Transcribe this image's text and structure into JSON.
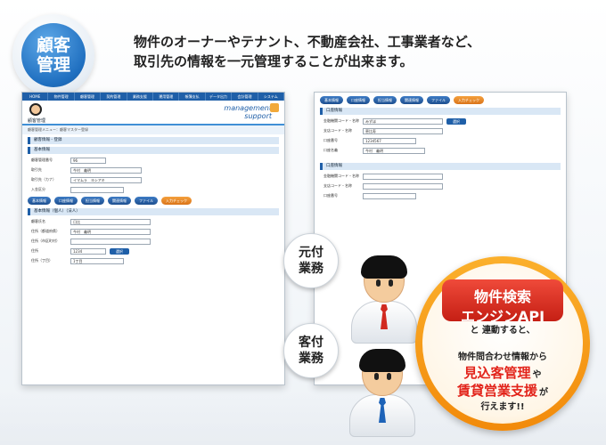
{
  "badge": {
    "line1": "顧客",
    "line2": "管理"
  },
  "headline": {
    "line1": "物件のオーナーやテナント、不動産会社、工事業者など、",
    "line2": "取引先の情報を一元管理することが出来ます。"
  },
  "left_screen": {
    "menu": [
      "HOME",
      "物件管理",
      "顧客管理",
      "契約管理",
      "業務支援",
      "運用管理",
      "帳簿支払",
      "データ出力",
      "会計管理",
      "システム"
    ],
    "user_label": "顧客管理",
    "brand_line1": "management",
    "brand_line2": "support",
    "crumb": "顧客管理メニュー：顧客マスター登録",
    "section1": "顧客情報 - 登録",
    "section2": "基本情報",
    "fields": [
      {
        "label": "顧客管理番号",
        "value": "96"
      },
      {
        "label": "取引先",
        "value": "今村　義明"
      },
      {
        "label": "取引先（カナ）",
        "value": "イマムラ　ヨシアキ"
      },
      {
        "label": "入金区分",
        "value": ""
      }
    ],
    "pills": [
      "基本情報",
      "口座情報",
      "担当情報",
      "関連情報",
      "ファイル"
    ],
    "pill_orange": "入力チェック",
    "section3": "基本情報（個人）（法人）",
    "fields2": [
      {
        "label": "顧客氏名",
        "value": "日比"
      },
      {
        "label": "住所（都道府県）",
        "value": "今村　義明"
      },
      {
        "label": "住所（市区町村）",
        "value": ""
      },
      {
        "label": "住所",
        "value": "1234"
      },
      {
        "label": "住所（丁目）",
        "value": "1丁目"
      }
    ],
    "button": "選択"
  },
  "right_screen": {
    "pills": [
      "基本情報",
      "口座情報",
      "担当情報",
      "関連情報",
      "ファイル"
    ],
    "pill_orange": "入力チェック",
    "section1": "口座情報",
    "fields": [
      {
        "label": "金融機関コード・名称",
        "value": "みずほ"
      },
      {
        "label": "支店コード・名称",
        "value": "恵比寿"
      },
      {
        "label": "口座番号",
        "value": "1234567"
      },
      {
        "label": "口座名義",
        "value": "今村　義明"
      }
    ],
    "section2": "口座情報",
    "fields2": [
      {
        "label": "金融機関コード・名称",
        "value": ""
      },
      {
        "label": "支店コード・名称",
        "value": ""
      },
      {
        "label": "口座番号",
        "value": ""
      }
    ],
    "button": "選択"
  },
  "bubbles": [
    {
      "line1": "元付",
      "line2": "業務"
    },
    {
      "line1": "客付",
      "line2": "業務"
    }
  ],
  "callout": {
    "title1": "物件検索",
    "title2": "エンジンAPI",
    "title2_tail": "と",
    "line3": "連動すると、",
    "line4": "物件問合わせ情報から",
    "emph1": "見込客管理",
    "emph1_tail": "や",
    "emph2": "賃貸営業支援",
    "emph2_tail": "が",
    "line7": "行えます!!"
  }
}
